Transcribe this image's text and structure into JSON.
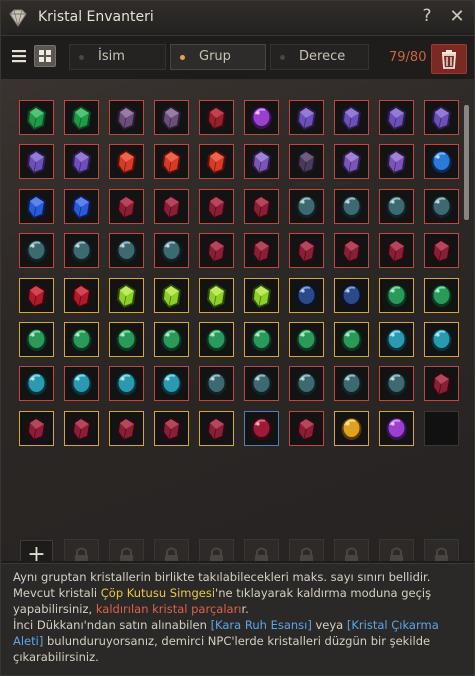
{
  "window": {
    "title": "Kristal Envanteri",
    "help_icon": "?",
    "close_icon": "✕"
  },
  "toolbar": {
    "tabs": [
      {
        "label": "İsim",
        "selected": false
      },
      {
        "label": "Grup",
        "selected": true
      },
      {
        "label": "Derece",
        "selected": false
      }
    ],
    "count": "79/80",
    "add_label": "+"
  },
  "info": {
    "l1": "Aynı gruptan kristallerin birlikte takılabilecekleri maks. sayı sınırı bellidir.",
    "l2a": "Mevcut kristali ",
    "l2b": "Çöp Kutusu Simgesi",
    "l2c": "'ne tıklayarak kaldırma moduna geçiş",
    "l3a": "yapabilirsiniz, ",
    "l3b": "kaldırılan kristal parçaları",
    "l3c": "r.",
    "l4a": "İnci Dükkanı'ndan satın alınabilen ",
    "l4b": "[Kara Ruh Esansı]",
    "l4c": " veya ",
    "l4d": "[Kristal Çıkarma",
    "l5a": "Aleti]",
    "l5b": " bulunduruyorsanız, demirci NPC'lerde kristalleri düzgün bir şekilde",
    "l6": "çıkarabilirsiniz."
  },
  "colors": {
    "accent": "#c9663c",
    "slot_border": "#c0473f",
    "gold_border": "#d8a53a",
    "trash": "#7a2a22"
  },
  "grid": {
    "rows": [
      [
        "green",
        "green",
        "violet-dark",
        "violet-dark",
        "red-dark",
        "purple-round",
        "purple",
        "purple",
        "purple",
        "purple"
      ],
      [
        "purple",
        "purple",
        "red",
        "red",
        "red",
        "violet",
        "purple-dark",
        "violet",
        "violet",
        "blue-drop"
      ],
      [
        "blue",
        "blue",
        "crimson",
        "crimson",
        "crimson",
        "crimson",
        "teal",
        "teal",
        "teal",
        "teal"
      ],
      [
        "teal",
        "teal",
        "teal",
        "teal",
        "crimson",
        "crimson",
        "crimson",
        "crimson",
        "crimson",
        "crimson"
      ],
      [
        "ruby",
        "ruby",
        "lime",
        "lime",
        "lime",
        "lime",
        "navy",
        "navy",
        "emerald",
        "emerald"
      ],
      [
        "emerald",
        "emerald",
        "emerald",
        "emerald",
        "emerald",
        "emerald",
        "emerald",
        "emerald",
        "aqua",
        "aqua"
      ],
      [
        "aqua",
        "aqua",
        "aqua",
        "aqua",
        "teal",
        "teal",
        "teal",
        "teal",
        "teal",
        "crimson"
      ],
      [
        "crimson",
        "crimson",
        "crimson",
        "crimson",
        "crimson",
        "ruby-round",
        "crimson",
        "gold",
        "purple-round",
        "empty"
      ]
    ],
    "row_borders": [
      [
        "r",
        "r",
        "r",
        "r",
        "r",
        "r",
        "r",
        "r",
        "r",
        "r"
      ],
      [
        "r",
        "r",
        "r",
        "r",
        "r",
        "r",
        "r",
        "r",
        "r",
        "r"
      ],
      [
        "r",
        "r",
        "r",
        "r",
        "r",
        "r",
        "r",
        "r",
        "r",
        "r"
      ],
      [
        "r",
        "r",
        "r",
        "r",
        "r",
        "r",
        "r",
        "r",
        "r",
        "r"
      ],
      [
        "g",
        "g",
        "g",
        "g",
        "g",
        "g",
        "g",
        "g",
        "g",
        "g"
      ],
      [
        "g",
        "g",
        "g",
        "g",
        "g",
        "g",
        "g",
        "g",
        "g",
        "g"
      ],
      [
        "r",
        "r",
        "r",
        "r",
        "r",
        "r",
        "r",
        "r",
        "r",
        "r"
      ],
      [
        "g",
        "g",
        "g",
        "g",
        "g",
        "b",
        "r",
        "g",
        "g",
        "e"
      ]
    ]
  }
}
